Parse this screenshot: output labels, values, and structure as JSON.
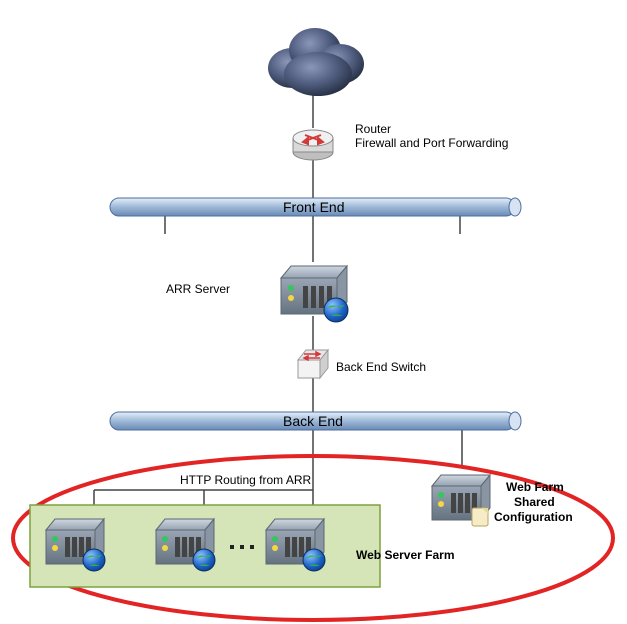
{
  "labels": {
    "router_line1": "Router",
    "router_line2": "Firewall and Port Forwarding",
    "front_end": "Front End",
    "arr_server": "ARR Server",
    "back_end_switch": "Back End Switch",
    "back_end": "Back End",
    "http_routing": "HTTP Routing from ARR",
    "web_server_farm": "Web Server Farm",
    "webfarm_shared_line1": "Web Farm",
    "webfarm_shared_line2": "Shared",
    "webfarm_shared_line3": "Configuration"
  },
  "colors": {
    "pipe_fill": "#9db8d7",
    "pipe_stroke": "#4b6ea0",
    "server_body": "#aeb9c5",
    "server_face": "#7d8a9a",
    "server_light_green": "#34c759",
    "server_light_yellow": "#f5d742",
    "globe_blue": "#1e63c8",
    "globe_green": "#2dbb2d",
    "cloud_dark": "#2d3a52",
    "cloud_mid": "#546184",
    "router_body": "#e5e5e5",
    "switch_body": "#e5e5e5",
    "arrows_red": "#d23a3a",
    "farm_bg": "#d5e5b8",
    "farm_border": "#7ea23f",
    "red_ellipse": "#e22424",
    "line": "#444"
  }
}
